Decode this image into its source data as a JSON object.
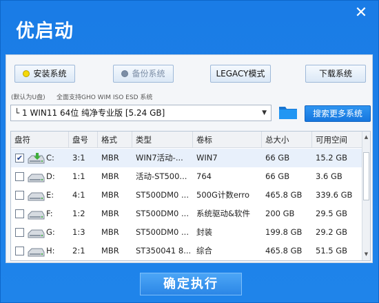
{
  "app": {
    "title": "优启动",
    "close_glyph": "✕"
  },
  "tabs": [
    {
      "label": "安装系统",
      "state": "active"
    },
    {
      "label": "备份系统",
      "state": "disabled"
    },
    {
      "label": "LEGACY模式",
      "state": "normal"
    },
    {
      "label": "下载系统",
      "state": "normal"
    }
  ],
  "hints": {
    "default_disk": "(默认为U盘)",
    "support": "全面支持GHO WIM ISO ESD 系统"
  },
  "image_select": {
    "value": "└ 1 WIN11 64位 纯净专业版 [5.24 GB]",
    "arrow": "▼"
  },
  "search_more": "搜索更多系统",
  "table": {
    "headers": [
      "盘符",
      "盘号",
      "格式",
      "类型",
      "卷标",
      "总大小",
      "可用空间"
    ],
    "rows": [
      {
        "checked": true,
        "drive": "C:",
        "disk": "3:1",
        "format": "MBR",
        "type": "WIN7活动-...",
        "label": "WIN7",
        "total": "66 GB",
        "free": "15.2 GB"
      },
      {
        "checked": false,
        "drive": "D:",
        "disk": "1:1",
        "format": "MBR",
        "type": "活动-ST500...",
        "label": "764",
        "total": "66 GB",
        "free": "3.6 GB"
      },
      {
        "checked": false,
        "drive": "E:",
        "disk": "4:1",
        "format": "MBR",
        "type": "ST500DM0 ...",
        "label": "500G计数erro",
        "total": "465.8 GB",
        "free": "339.6 GB"
      },
      {
        "checked": false,
        "drive": "F:",
        "disk": "1:2",
        "format": "MBR",
        "type": "ST500DM0 ...",
        "label": "系统驱动&软件",
        "total": "200 GB",
        "free": "29.5 GB"
      },
      {
        "checked": false,
        "drive": "G:",
        "disk": "1:3",
        "format": "MBR",
        "type": "ST500DM0 ...",
        "label": "封装",
        "total": "199.8 GB",
        "free": "29.2 GB"
      },
      {
        "checked": false,
        "drive": "H:",
        "disk": "2:1",
        "format": "MBR",
        "type": "ST350041 8...",
        "label": "综合",
        "total": "465.8 GB",
        "free": "51.5 GB"
      }
    ]
  },
  "confirm": "确定执行"
}
